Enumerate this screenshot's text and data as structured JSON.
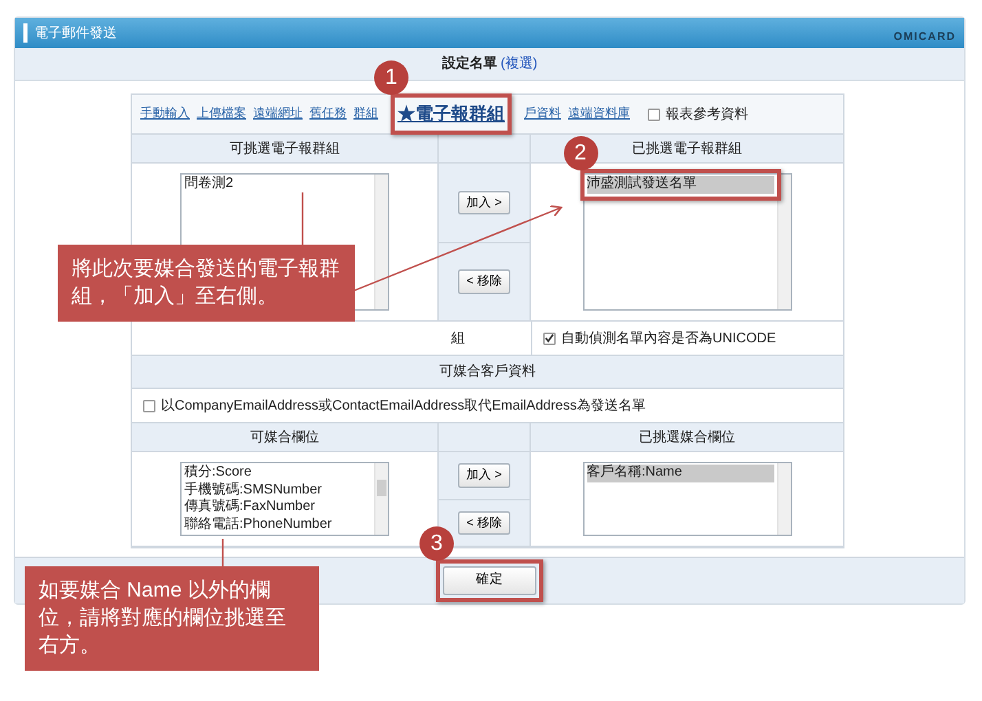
{
  "window": {
    "title": "電子郵件發送",
    "logo": "OMICARD"
  },
  "heading": {
    "label": "設定名單",
    "hint": "(複選)"
  },
  "source_tabs": [
    {
      "label": "手動輸入",
      "selected": false
    },
    {
      "label": "上傳檔案",
      "selected": false
    },
    {
      "label": "遠端網址",
      "selected": false
    },
    {
      "label": "舊任務",
      "selected": false
    },
    {
      "label": "群組",
      "selected": false
    },
    {
      "label": "★電子報群組",
      "selected": true
    },
    {
      "label": "戶資料",
      "selected": false
    },
    {
      "label": "遠端資料庫",
      "selected": false
    }
  ],
  "report_checkbox": {
    "label": "報表參考資料",
    "checked": false
  },
  "group_picker": {
    "available_header": "可挑選電子報群組",
    "chosen_header": "已挑選電子報群組",
    "add_button": "加入 >",
    "remove_button": "< 移除",
    "available": [
      {
        "label": "問卷測2",
        "selected": false
      }
    ],
    "chosen": [
      {
        "label": "沛盛測試發送名單",
        "selected": true
      }
    ]
  },
  "left_option_text": "組",
  "unicode_checkbox": {
    "label": "自動偵測名單內容是否為UNICODE",
    "checked": true
  },
  "customer_section": {
    "title": "可媒合客戶資料",
    "replace_checkbox": {
      "label": "以CompanyEmailAddress或ContactEmailAddress取代EmailAddress為發送名單",
      "checked": false
    },
    "available_header": "可媒合欄位",
    "chosen_header": "已挑選媒合欄位",
    "add_button": "加入 >",
    "remove_button": "< 移除",
    "available": [
      {
        "label": "積分:Score",
        "selected": false
      },
      {
        "label": "手機號碼:SMSNumber",
        "selected": false
      },
      {
        "label": "傳真號碼:FaxNumber",
        "selected": false
      },
      {
        "label": "聯絡電話:PhoneNumber",
        "selected": false
      }
    ],
    "chosen": [
      {
        "label": "客戶名稱:Name",
        "selected": true
      }
    ]
  },
  "confirm_button": "確定",
  "step_markers": [
    {
      "number": "1"
    },
    {
      "number": "2"
    },
    {
      "number": "3"
    }
  ],
  "callouts": [
    {
      "text": "將此次要媒合發送的電子報群組，「加入」至右側。"
    },
    {
      "text": "如要媒合 Name 以外的欄位，請將對應的欄位挑選至右方。"
    }
  ]
}
